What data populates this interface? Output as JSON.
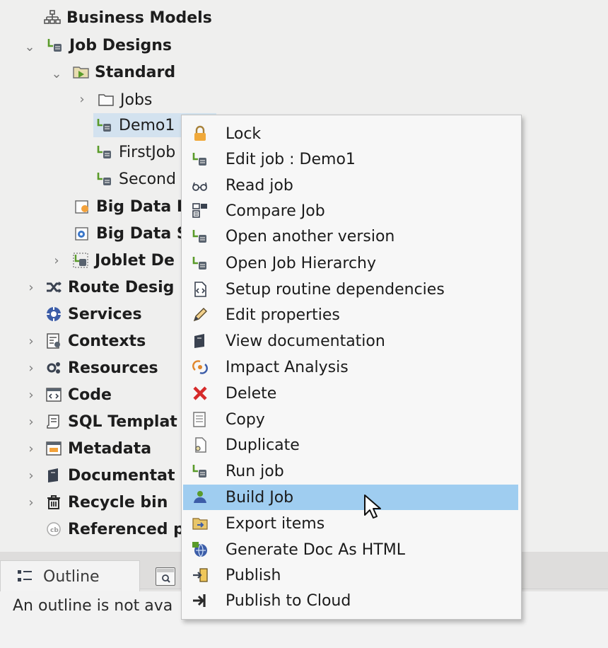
{
  "tree": {
    "items": [
      {
        "label": "Business Models",
        "icon": "business-models-icon"
      },
      {
        "label": "Job Designs",
        "icon": "job-designs-icon"
      },
      {
        "label": "Standard",
        "icon": "standard-folder-icon"
      },
      {
        "label": "Jobs",
        "icon": "folder-icon"
      },
      {
        "label": "Demo1",
        "icon": "job-icon"
      },
      {
        "label": "FirstJob",
        "icon": "job-icon"
      },
      {
        "label": "Second",
        "icon": "job-icon"
      },
      {
        "label": "Big Data I",
        "icon": "big-data-batch-icon"
      },
      {
        "label": "Big Data S",
        "icon": "big-data-streaming-icon"
      },
      {
        "label": "Joblet De",
        "icon": "joblet-icon"
      },
      {
        "label": "Route Desig",
        "icon": "route-icon"
      },
      {
        "label": "Services",
        "icon": "services-icon"
      },
      {
        "label": "Contexts",
        "icon": "contexts-icon"
      },
      {
        "label": "Resources",
        "icon": "resources-icon"
      },
      {
        "label": "Code",
        "icon": "code-icon"
      },
      {
        "label": "SQL Templat",
        "icon": "sql-template-icon"
      },
      {
        "label": "Metadata",
        "icon": "metadata-icon"
      },
      {
        "label": "Documentat",
        "icon": "documentation-icon"
      },
      {
        "label": "Recycle bin",
        "icon": "recycle-bin-icon"
      },
      {
        "label": "Referenced p",
        "icon": "referenced-projects-icon"
      }
    ]
  },
  "context_menu": {
    "items": [
      {
        "label": "Lock",
        "icon": "lock-icon"
      },
      {
        "label": "Edit job : Demo1",
        "icon": "edit-job-icon"
      },
      {
        "label": "Read job",
        "icon": "glasses-icon"
      },
      {
        "label": "Compare Job",
        "icon": "compare-icon"
      },
      {
        "label": "Open another version",
        "icon": "job-version-icon"
      },
      {
        "label": "Open Job Hierarchy",
        "icon": "job-hierarchy-icon"
      },
      {
        "label": "Setup routine dependencies",
        "icon": "routine-dependencies-icon"
      },
      {
        "label": "Edit properties",
        "icon": "pencil-icon"
      },
      {
        "label": "View documentation",
        "icon": "book-icon"
      },
      {
        "label": "Impact Analysis",
        "icon": "impact-analysis-icon"
      },
      {
        "label": "Delete",
        "icon": "delete-x-icon"
      },
      {
        "label": "Copy",
        "icon": "copy-icon"
      },
      {
        "label": "Duplicate",
        "icon": "duplicate-icon"
      },
      {
        "label": "Run job",
        "icon": "run-job-icon"
      },
      {
        "label": "Build Job",
        "icon": "build-job-icon"
      },
      {
        "label": "Export items",
        "icon": "export-icon"
      },
      {
        "label": "Generate Doc As HTML",
        "icon": "generate-doc-icon"
      },
      {
        "label": "Publish",
        "icon": "publish-icon"
      },
      {
        "label": "Publish to Cloud",
        "icon": "publish-cloud-icon"
      }
    ],
    "highlighted": "Build Job"
  },
  "bottom_panel": {
    "tab_outline_label": "Outline",
    "outline_message": "An outline is not ava"
  },
  "colors": {
    "menu_highlight": "#9fcdf0",
    "tree_selection": "#d3e2ef",
    "job_icon_green": "#5a9b2a",
    "delete_red": "#d62a2a"
  }
}
